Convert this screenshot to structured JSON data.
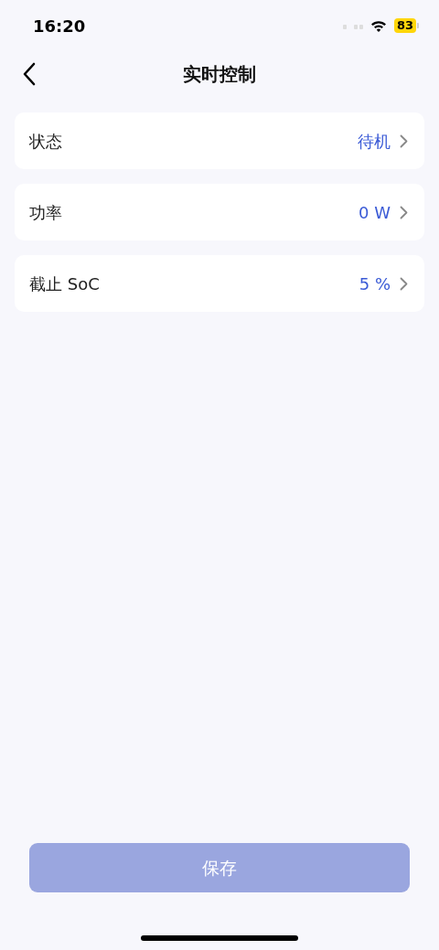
{
  "status_bar": {
    "time": "16:20",
    "battery": "83"
  },
  "nav": {
    "title": "实时控制"
  },
  "rows": [
    {
      "label": "状态",
      "value": "待机"
    },
    {
      "label": "功率",
      "value": "0 W"
    },
    {
      "label": "截止 SoC",
      "value": "5 %"
    }
  ],
  "save_button": {
    "label": "保存",
    "disabled": true
  }
}
